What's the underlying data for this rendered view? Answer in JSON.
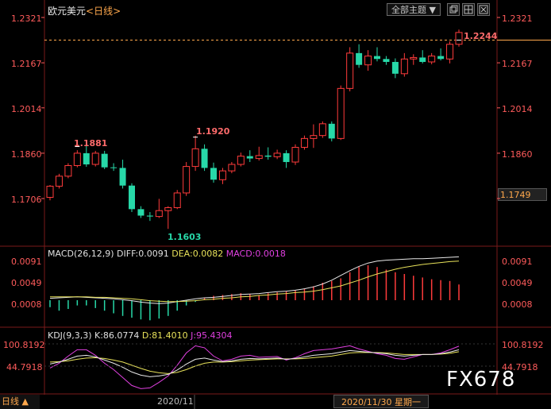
{
  "header": {
    "symbol": "欧元美元",
    "period_text": "<日线>",
    "topic_button": "全部主题 ▼",
    "icon_buttons": [
      "window-restore-icon",
      "grid-icon",
      "close-panel-icon"
    ],
    "top_right_price": "1.2321"
  },
  "price_axis": {
    "left_labels": [
      "1.2321",
      "1.2167",
      "1.2014",
      "1.1860",
      "1.1706"
    ],
    "right_labels": [
      "1.2321",
      "1.2167",
      "1.2014",
      "1.1860"
    ],
    "current_price": "1.1749",
    "colors": {
      "up": "#ff3b3b",
      "down": "#27d8a8",
      "label": "#ff5b5b",
      "ref_line": "#ffa84c"
    }
  },
  "annotations": {
    "high1": "1.1881",
    "high2": "1.1920",
    "low": "1.1603",
    "last_high": "1.2244"
  },
  "macd": {
    "label_prefix": "MACD(26,12,9)",
    "diff": "DIFF:0.0091",
    "dea": "DEA:0.0082",
    "macd": "MACD:0.0018",
    "left_labels": [
      "0.0091",
      "0.0049",
      "0.0008"
    ],
    "right_labels": [
      "0.0091",
      "0.0049",
      "0.0008"
    ]
  },
  "kdj": {
    "label_prefix": "KDJ(9,3,3)",
    "k": "K:86.0774",
    "d": "D:81.4010",
    "j": "J:95.4304",
    "left_labels": [
      "100.8192",
      "44.7918"
    ],
    "right_labels": [
      "100.8192",
      "44.7918"
    ]
  },
  "footer": {
    "period": "日线 ▲",
    "month_label": "2020/11",
    "crosshair_date": "2020/11/30 星期一"
  },
  "watermark": "FX678",
  "chart_data": {
    "type": "candlestick",
    "title": "欧元美元 <日线>",
    "ylim": [
      1.155,
      1.235
    ],
    "candles": [
      [
        1.171,
        1.1752,
        1.17,
        1.1748
      ],
      [
        1.1748,
        1.179,
        1.174,
        1.1782
      ],
      [
        1.1782,
        1.1826,
        1.1775,
        1.1818
      ],
      [
        1.1818,
        1.187,
        1.1812,
        1.186
      ],
      [
        1.186,
        1.1888,
        1.1814,
        1.1822
      ],
      [
        1.1822,
        1.1868,
        1.1815,
        1.186
      ],
      [
        1.1858,
        1.1868,
        1.1806,
        1.1812
      ],
      [
        1.1812,
        1.1826,
        1.18,
        1.181
      ],
      [
        1.181,
        1.1838,
        1.174,
        1.175
      ],
      [
        1.175,
        1.1758,
        1.166,
        1.167
      ],
      [
        1.167,
        1.168,
        1.164,
        1.1648
      ],
      [
        1.1648,
        1.166,
        1.163,
        1.1645
      ],
      [
        1.1645,
        1.1705,
        1.164,
        1.1665
      ],
      [
        1.1665,
        1.168,
        1.1603,
        1.1675
      ],
      [
        1.1675,
        1.1735,
        1.167,
        1.1725
      ],
      [
        1.1725,
        1.183,
        1.1715,
        1.1815
      ],
      [
        1.1815,
        1.192,
        1.18,
        1.1875
      ],
      [
        1.1875,
        1.189,
        1.18,
        1.181
      ],
      [
        1.181,
        1.1828,
        1.176,
        1.177
      ],
      [
        1.177,
        1.181,
        1.1755,
        1.18
      ],
      [
        1.18,
        1.183,
        1.1792,
        1.1822
      ],
      [
        1.1822,
        1.1862,
        1.1815,
        1.185
      ],
      [
        1.185,
        1.187,
        1.183,
        1.1842
      ],
      [
        1.1842,
        1.1882,
        1.1835,
        1.1852
      ],
      [
        1.1852,
        1.188,
        1.1838,
        1.1848
      ],
      [
        1.1848,
        1.1872,
        1.184,
        1.186
      ],
      [
        1.186,
        1.187,
        1.181,
        1.183
      ],
      [
        1.183,
        1.189,
        1.182,
        1.188
      ],
      [
        1.188,
        1.192,
        1.1872,
        1.191
      ],
      [
        1.191,
        1.1958,
        1.1878,
        1.192
      ],
      [
        1.192,
        1.1968,
        1.1912,
        1.196
      ],
      [
        1.196,
        1.1968,
        1.19,
        1.191
      ],
      [
        1.191,
        1.209,
        1.1905,
        1.208
      ],
      [
        1.208,
        1.222,
        1.207,
        1.22
      ],
      [
        1.22,
        1.223,
        1.215,
        1.216
      ],
      [
        1.216,
        1.221,
        1.214,
        1.219
      ],
      [
        1.219,
        1.222,
        1.2172,
        1.218
      ],
      [
        1.218,
        1.219,
        1.216,
        1.217
      ],
      [
        1.217,
        1.2182,
        1.2115,
        1.213
      ],
      [
        1.213,
        1.22,
        1.212,
        1.218
      ],
      [
        1.218,
        1.2196,
        1.216,
        1.2185
      ],
      [
        1.2185,
        1.221,
        1.2165,
        1.217
      ],
      [
        1.217,
        1.22,
        1.2162,
        1.219
      ],
      [
        1.219,
        1.2216,
        1.2175,
        1.218
      ],
      [
        1.218,
        1.224,
        1.2165,
        1.223
      ],
      [
        1.223,
        1.228,
        1.2222,
        1.227
      ]
    ],
    "macd_hist": [
      -0.0008,
      -0.0012,
      -0.001,
      -0.0006,
      -0.0006,
      -0.0009,
      -0.0012,
      -0.0015,
      -0.0018,
      -0.002,
      -0.0022,
      -0.0023,
      -0.0021,
      -0.0018,
      -0.0012,
      -0.0006,
      -0.0002,
      0.0003,
      0.0005,
      0.0006,
      0.0007,
      0.0008,
      0.0007,
      0.0006,
      0.0008,
      0.0009,
      0.001,
      0.0011,
      0.0013,
      0.0016,
      0.002,
      0.0022,
      0.0025,
      0.0032,
      0.0038,
      0.004,
      0.0038,
      0.0035,
      0.0032,
      0.003,
      0.0028,
      0.0026,
      0.0024,
      0.0023,
      0.0022,
      0.0018
    ],
    "macd_diff": [
      0.0004,
      0.0005,
      0.0006,
      0.0007,
      0.0006,
      0.0005,
      0.0004,
      0.0003,
      0.0001,
      -0.0001,
      -0.0004,
      -0.0006,
      -0.0007,
      -0.0006,
      -0.0003,
      0.0,
      0.0003,
      0.0005,
      0.0006,
      0.0008,
      0.001,
      0.0012,
      0.0013,
      0.0014,
      0.0016,
      0.0018,
      0.0019,
      0.0021,
      0.0024,
      0.0028,
      0.0034,
      0.0042,
      0.0052,
      0.0062,
      0.0071,
      0.0078,
      0.0082,
      0.0084,
      0.0085,
      0.0086,
      0.0087,
      0.0087,
      0.0088,
      0.0089,
      0.009,
      0.0091
    ],
    "macd_dea": [
      0.0007,
      0.0007,
      0.0007,
      0.0007,
      0.0007,
      0.0006,
      0.0006,
      0.0005,
      0.0004,
      0.0003,
      0.0001,
      -0.0001,
      -0.0002,
      -0.0003,
      -0.0003,
      -0.0002,
      -0.0001,
      0.0001,
      0.0002,
      0.0004,
      0.0005,
      0.0007,
      0.0008,
      0.001,
      0.0011,
      0.0013,
      0.0014,
      0.0016,
      0.0017,
      0.0019,
      0.0022,
      0.0026,
      0.003,
      0.0036,
      0.0042,
      0.0049,
      0.0055,
      0.006,
      0.0065,
      0.0069,
      0.0072,
      0.0075,
      0.0077,
      0.0079,
      0.0081,
      0.0082
    ],
    "kdj_k": [
      50,
      55,
      62,
      70,
      72,
      68,
      60,
      52,
      42,
      30,
      22,
      18,
      20,
      24,
      35,
      50,
      62,
      65,
      60,
      56,
      58,
      62,
      64,
      63,
      64,
      65,
      62,
      64,
      68,
      72,
      74,
      76,
      80,
      84,
      82,
      80,
      78,
      76,
      72,
      70,
      72,
      74,
      74,
      76,
      80,
      86
    ],
    "kdj_d": [
      55,
      56,
      58,
      62,
      65,
      66,
      64,
      60,
      55,
      47,
      39,
      32,
      28,
      26,
      29,
      36,
      45,
      52,
      55,
      55,
      56,
      58,
      60,
      61,
      62,
      63,
      63,
      63,
      64,
      66,
      68,
      70,
      74,
      78,
      79,
      79,
      79,
      78,
      76,
      74,
      74,
      74,
      74,
      75,
      77,
      81
    ],
    "kdj_j": [
      40,
      52,
      70,
      86,
      86,
      72,
      52,
      36,
      16,
      -4,
      -12,
      -10,
      4,
      20,
      47,
      78,
      96,
      91,
      70,
      58,
      62,
      70,
      72,
      67,
      68,
      69,
      60,
      66,
      76,
      84,
      86,
      88,
      92,
      96,
      88,
      82,
      76,
      72,
      64,
      62,
      68,
      74,
      74,
      78,
      86,
      95
    ]
  }
}
